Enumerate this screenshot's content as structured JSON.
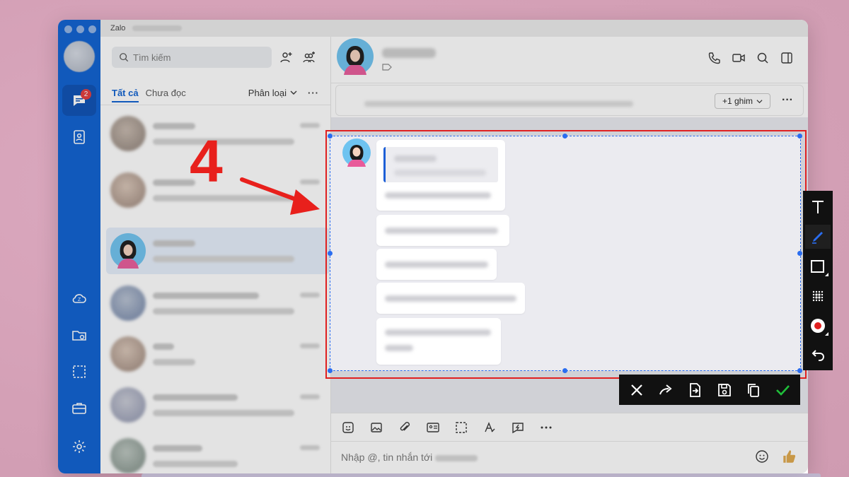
{
  "window": {
    "app_title": "Zalo"
  },
  "navbar": {
    "messages_badge": "2"
  },
  "list": {
    "search_placeholder": "Tìm kiếm",
    "tabs": {
      "all": "Tất cả",
      "unread": "Chưa đọc"
    },
    "filter_label": "Phân loại",
    "more": "···"
  },
  "chat": {
    "pin_button": "+1 ghim",
    "pin_more": "···",
    "composer_placeholder": "Nhập @, tin nhắn tới"
  },
  "annotation": {
    "step_number": "4",
    "color": "#e8201c"
  },
  "colors": {
    "accent": "#0b5fd1",
    "selection": "#2a6df0",
    "badge": "#e43a3a",
    "confirm": "#1fbf3a"
  },
  "screenshot_tools": [
    "text-tool",
    "pen-tool",
    "rectangle-tool",
    "mosaic-tool",
    "record-color-tool",
    "undo-tool"
  ],
  "screenshot_actions": [
    "close",
    "share",
    "send-to-chat",
    "save",
    "copy",
    "confirm"
  ]
}
